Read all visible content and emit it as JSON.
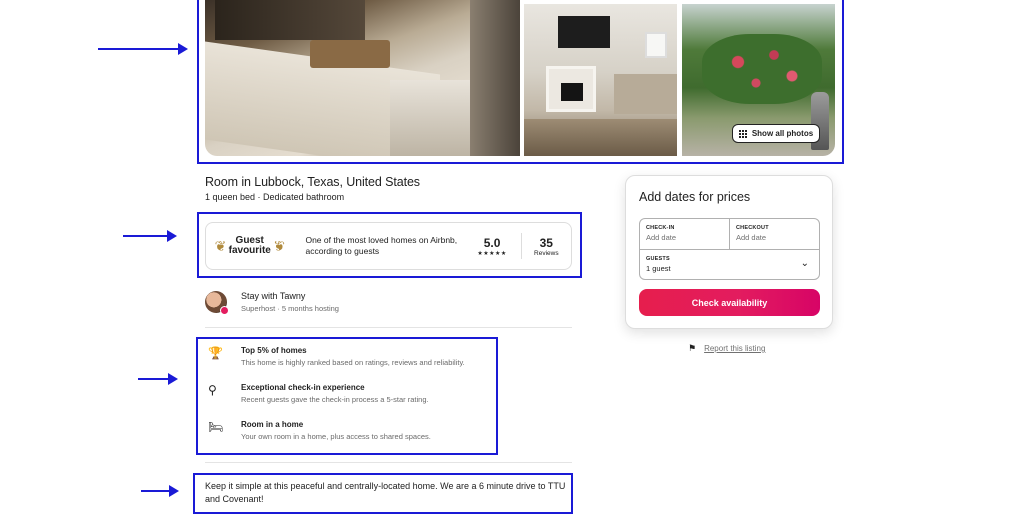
{
  "gallery": {
    "show_all_photos_label": "Show all photos"
  },
  "listing": {
    "title": "Room in Lubbock, Texas, United States",
    "subtitle": "1 queen bed · Dedicated bathroom"
  },
  "guest_favourite": {
    "badge_line1": "Guest",
    "badge_line2": "favourite",
    "description": "One of the most loved homes on Airbnb, according to guests",
    "rating": "5.0",
    "stars": "★★★★★",
    "reviews_count": "35",
    "reviews_label": "Reviews"
  },
  "host": {
    "name_line": "Stay with Tawny",
    "sub_line": "Superhost · 5 months hosting"
  },
  "highlights": [
    {
      "icon": "trophy-icon",
      "title": "Top 5% of homes",
      "desc": "This home is highly ranked based on ratings, reviews and reliability."
    },
    {
      "icon": "key-icon",
      "title": "Exceptional check-in experience",
      "desc": "Recent guests gave the check-in process a 5-star rating."
    },
    {
      "icon": "bed-icon",
      "title": "Room in a home",
      "desc": "Your own room in a home, plus access to shared spaces."
    }
  ],
  "description": "Keep it simple at this peaceful and centrally-located home. We are a 6 minute drive to TTU and Covenant!",
  "booking": {
    "title": "Add dates for prices",
    "checkin_label": "CHECK-IN",
    "checkin_value": "Add date",
    "checkout_label": "CHECKOUT",
    "checkout_value": "Add date",
    "guests_label": "GUESTS",
    "guests_value": "1 guest",
    "button_label": "Check availability"
  },
  "report_label": "Report this listing",
  "colors": {
    "annotation": "#1a1ad6",
    "brand": "#e31c5f"
  }
}
